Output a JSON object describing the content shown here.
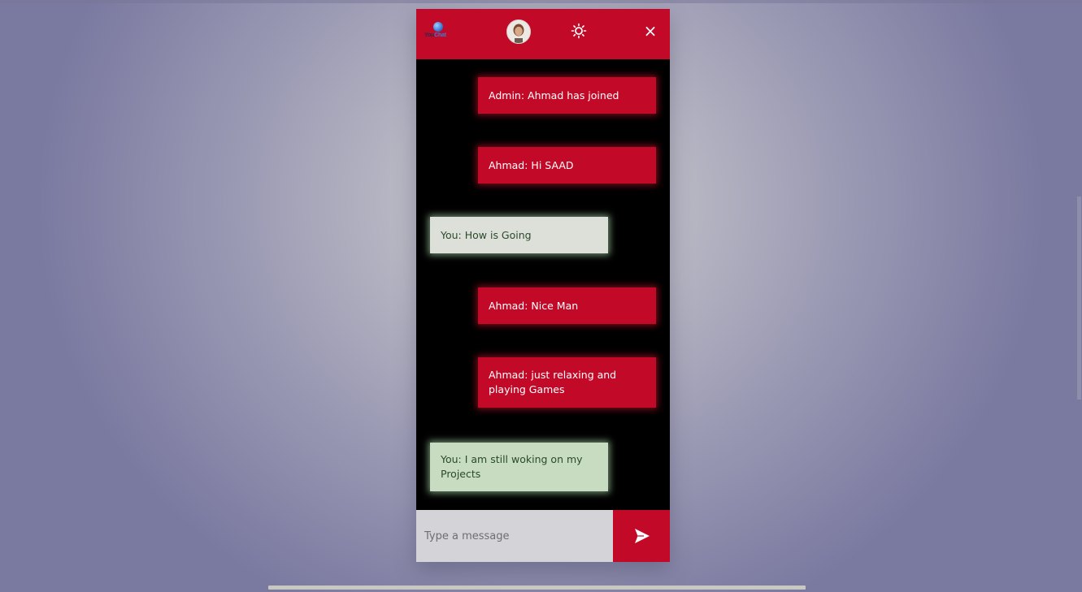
{
  "header": {
    "logo_text_prefix": "You",
    "logo_text_suffix": "Chat",
    "avatar_icon": "user-avatar",
    "theme_toggle_icon": "sun-icon",
    "close_label": "×"
  },
  "messages": [
    {
      "text": "Admin: Ahmad has joined",
      "direction": "incoming"
    },
    {
      "text": "Ahmad: Hi SAAD",
      "direction": "incoming"
    },
    {
      "text": "You: How is Going",
      "direction": "outgoing"
    },
    {
      "text": "Ahmad: Nice Man",
      "direction": "incoming"
    },
    {
      "text": "Ahmad: just relaxing and playing Games",
      "direction": "incoming"
    },
    {
      "text": "You: I am still woking on my Projects",
      "direction": "outgoing"
    }
  ],
  "composer": {
    "placeholder": "Type a message",
    "value": "",
    "send_icon": "send-icon"
  },
  "colors": {
    "accent": "#c20a28",
    "chat_background": "#000000",
    "outgoing_bubble": "#dde0d9",
    "outgoing_text": "#2a4a2a",
    "incoming_text": "#ffffff"
  }
}
